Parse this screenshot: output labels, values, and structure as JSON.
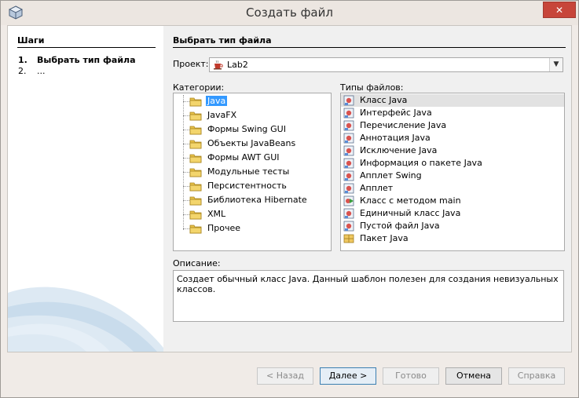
{
  "window": {
    "title": "Создать файл",
    "close_glyph": "✕"
  },
  "steps": {
    "title": "Шаги",
    "items": [
      {
        "num": "1.",
        "label": "Выбрать тип файла",
        "active": true
      },
      {
        "num": "2.",
        "label": "...",
        "active": false
      }
    ]
  },
  "main": {
    "title": "Выбрать тип файла",
    "project": {
      "label": "Проект:",
      "value": "Lab2",
      "icon": "coffee-cup-icon"
    },
    "categories": {
      "label": "Категории:",
      "items": [
        "Java",
        "JavaFX",
        "Формы Swing GUI",
        "Объекты JavaBeans",
        "Формы AWT GUI",
        "Модульные тесты",
        "Персистентность",
        "Библиотека Hibernate",
        "XML",
        "Прочее"
      ],
      "selected": "Java"
    },
    "file_types": {
      "label": "Типы файлов:",
      "items": [
        "Класс Java",
        "Интерфейс Java",
        "Перечисление Java",
        "Аннотация Java",
        "Исключение Java",
        "Информация о пакете Java",
        "Апплет Swing",
        "Апплет",
        "Класс с методом main",
        "Единичный класс Java",
        "Пустой файл Java",
        "Пакет Java"
      ],
      "selected": "Класс Java"
    },
    "description": {
      "label": "Описание:",
      "text": "Создает обычный класс Java. Данный шаблон полезен для создания невизуальных классов."
    }
  },
  "buttons": {
    "back": "< Назад",
    "next": "Далее >",
    "finish": "Готово",
    "cancel": "Отмена",
    "help": "Справка"
  },
  "colors": {
    "selection": "#3399ff",
    "close": "#c7453a",
    "accent": "#3c7fb1"
  }
}
